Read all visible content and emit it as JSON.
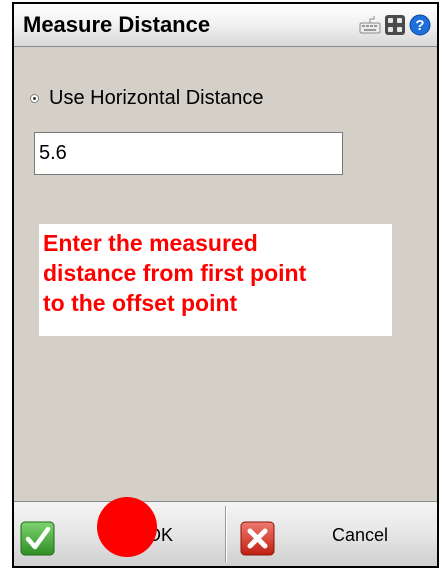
{
  "window": {
    "title": "Measure Distance",
    "title_icons": [
      "keyboard-icon",
      "grid-icon",
      "help-icon"
    ]
  },
  "form": {
    "radio_label": "Use Horizontal Distance",
    "radio_selected": true,
    "distance_value": "5.6"
  },
  "note": {
    "lines": [
      "Enter the measured",
      "distance from first point",
      "to the offset point"
    ],
    "color": "#ff0000"
  },
  "buttons": {
    "ok_label": "OK",
    "cancel_label": "Cancel"
  },
  "colors": {
    "panel_bg": "#d4d0c8",
    "ok_green": "#3fa535",
    "cancel_red": "#d42b1e",
    "help_blue": "#1e6fd9",
    "click_marker": "#ff0000"
  }
}
